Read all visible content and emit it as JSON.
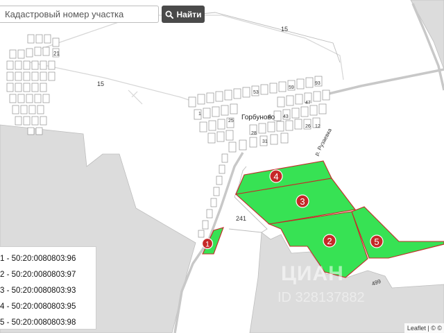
{
  "search": {
    "placeholder": "Кадастровый номер участка",
    "button_label": "Найти",
    "button_icon": "search-icon"
  },
  "map": {
    "labels": {
      "road_15_top": "15",
      "road_15_left": "15",
      "block_21": "21",
      "village_name": "Горбуново",
      "plot_241": "241",
      "plot_499": "499",
      "street_name": "р. Рузаевка",
      "house_1": "1",
      "house_25": "25",
      "house_53": "53",
      "house_59": "59",
      "house_93": "93",
      "house_8": "8",
      "house_43": "43",
      "house_28": "28",
      "house_26": "26",
      "house_12": "12",
      "house_31": "31",
      "house_47": "47"
    },
    "markers": [
      "1",
      "2",
      "3",
      "4",
      "5"
    ],
    "colors": {
      "parcel_fill": "#37e254",
      "parcel_border": "#c62828",
      "marker": "#c62828",
      "forest": "#dcdcdc",
      "road": "#c9c9c9"
    }
  },
  "legend": {
    "items": [
      "1 - 50:20:0080803:96",
      "2 - 50:20:0080803:97",
      "3 - 50:20:0080803:93",
      "4 - 50:20:0080803:95",
      "5 - 50:20:0080803:98"
    ]
  },
  "watermark": {
    "brand": "ЦИАН",
    "id_text": "ID 328137882"
  },
  "attribution": {
    "text": "Leaflet | © ©"
  }
}
